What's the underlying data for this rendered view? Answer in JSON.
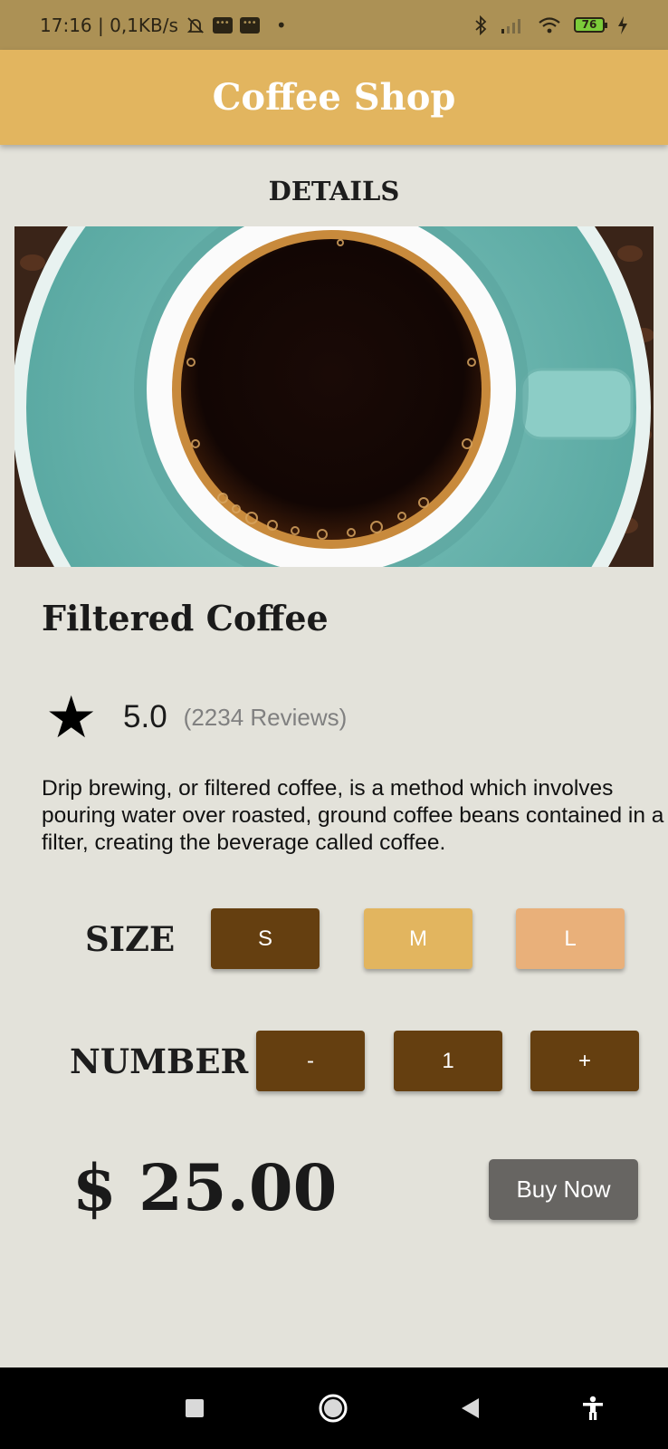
{
  "status_bar": {
    "time_speed": "17:16 | 0,1KB/s",
    "dot": "•",
    "battery": "76",
    "icons": [
      "mute-bell-icon",
      "message-icon",
      "message-icon",
      "bluetooth-icon",
      "signal-icon",
      "wifi-icon",
      "battery-icon",
      "charging-icon"
    ]
  },
  "app_bar": {
    "title": "Coffee Shop"
  },
  "page": {
    "heading": "DETAILS"
  },
  "product": {
    "name": "Filtered Coffee",
    "rating": "5.0",
    "reviews": "(2234 Reviews)",
    "description": "Drip brewing, or filtered coffee, is a method which involves pouring water over roasted, ground coffee beans contained in a filter, creating the beverage called coffee.",
    "price": "$ 25.00"
  },
  "size": {
    "label": "SIZE",
    "options": [
      "S",
      "M",
      "L"
    ],
    "selected": "S",
    "colors": {
      "S": "#653f10",
      "M": "#e2b55f",
      "L": "#e9b07a"
    }
  },
  "quantity": {
    "label": "NUMBER",
    "minus": "-",
    "value": "1",
    "plus": "+"
  },
  "actions": {
    "buy": "Buy Now"
  },
  "colors": {
    "app_bar": "#e2b55f",
    "background": "#e3e2da",
    "brown": "#653f10",
    "buy_button": "#676562"
  },
  "nav_bar": {
    "icons": [
      "recents-icon",
      "home-icon",
      "back-icon",
      "accessibility-icon"
    ]
  }
}
